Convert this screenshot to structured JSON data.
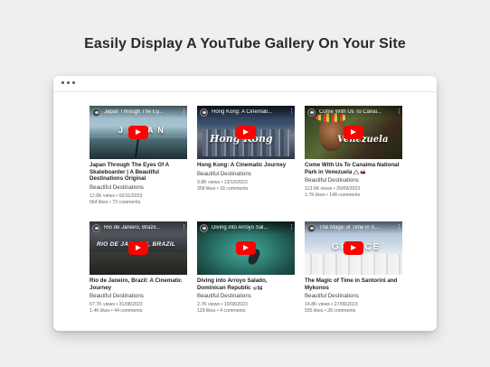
{
  "heading": "Easily Display A YouTube Gallery On Your Site",
  "videos": [
    {
      "thumb_title": "Japan Through The Ey...",
      "overlay": "JAPAN",
      "title": "Japan Through The Eyes Of A Skateboarder | A Beautiful Destinations Original",
      "channel": "Beautiful Destinations",
      "views": "12.6K views • 02/11/2023",
      "likes": "564 likes • 73 comments"
    },
    {
      "thumb_title": "Hong Kong: A Cinemati...",
      "overlay": "Hong Kong",
      "title": "Hong Kong: A Cinematic Journey",
      "channel": "Beautiful Destinations",
      "views": "9.8K views • 13/10/2023",
      "likes": "358 likes • 18 comments"
    },
    {
      "thumb_title": "Come With Us To Canai...",
      "overlay": "Venezuela",
      "title": "Come With Us To Canaima National Park in Venezuela",
      "title_suffix": "🇻🇪",
      "channel": "Beautiful Destinations",
      "views": "113.6K views • 25/09/2023",
      "likes": "1.7K likes • 148 comments"
    },
    {
      "thumb_title": "Rio de Janeiro, Brazil...",
      "overlay": "RIO DE JANEIRO, BRAZIL",
      "title": "Rio de Janeiro, Brazil: A Cinematic Journey",
      "channel": "Beautiful Destinations",
      "views": "67.7K views • 31/08/2023",
      "likes": "1.4K likes • 44 comments"
    },
    {
      "thumb_title": "Diving into Arroyo Sal...",
      "overlay": "",
      "title": "Diving into Arroyo Salado, Dominican Republic",
      "title_suffix": "🤿🇩🇴",
      "channel": "Beautiful Destinations",
      "views": "2.7K views • 10/08/2023",
      "likes": "129 likes • 4 comments"
    },
    {
      "thumb_title": "The Magic of Time in S...",
      "overlay": "GREECE",
      "title": "The Magic of Time in Santorini and Mykonos",
      "channel": "Beautiful Destinations",
      "views": "14.8K views • 27/06/2023",
      "likes": "555 likes • 28 comments"
    }
  ],
  "colors": {
    "play_button": "#ff0000",
    "page_bg": "#efefef"
  },
  "icons": {
    "play": "youtube-play-icon",
    "menu": "kebab-menu-icon",
    "warning": "warning-triangle-icon"
  }
}
